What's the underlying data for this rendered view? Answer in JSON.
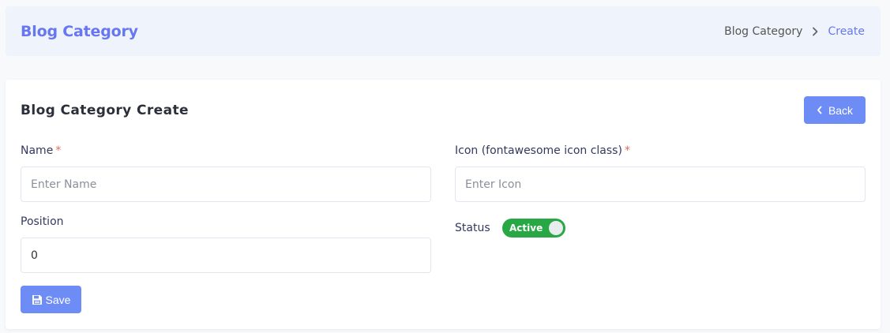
{
  "header": {
    "title": "Blog Category",
    "breadcrumb": [
      "Blog Category",
      "Create"
    ]
  },
  "card": {
    "title": "Blog Category Create",
    "back_label": "Back",
    "save_label": "Save"
  },
  "form": {
    "name": {
      "label": "Name",
      "required_mark": "*",
      "placeholder": "Enter Name",
      "value": ""
    },
    "icon": {
      "label": "Icon (fontawesome icon class)",
      "required_mark": "*",
      "placeholder": "Enter Icon",
      "value": ""
    },
    "position": {
      "label": "Position",
      "value": "0"
    },
    "status": {
      "label": "Status",
      "value": "Active"
    }
  },
  "colors": {
    "accent": "#6777ef",
    "button": "#6d8cf5",
    "toggle_on": "#28a745",
    "required": "#e36d5a"
  }
}
